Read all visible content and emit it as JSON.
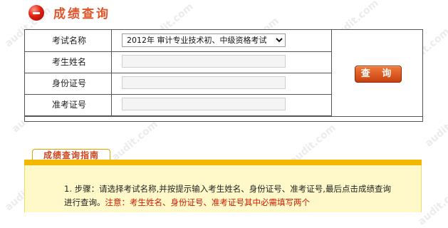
{
  "header": {
    "title": "成绩查询"
  },
  "form": {
    "rows": [
      {
        "label": "考试名称",
        "value": "2012年 审计专业技术初、中级资格考试"
      },
      {
        "label": "考生姓名",
        "value": ""
      },
      {
        "label": "身份证号",
        "value": ""
      },
      {
        "label": "准考证号",
        "value": ""
      }
    ],
    "query_button": "查 询"
  },
  "guide": {
    "tab": "成绩查询指南",
    "step_prefix": "1. 步骤：",
    "step_text": "请选择考试名称,并按提示输入考生姓名、身份证号、准考证号,最后点击成绩查询进行查询。",
    "note_label": "注意：",
    "note_text": "考生姓名、身份证号、准考证号其中必需填写两个"
  },
  "watermark": "audit.com",
  "colors": {
    "accent": "#e0552b",
    "button": "#d04a16",
    "guide_bar": "#f2b800",
    "guide_bg": "#fff8c8"
  }
}
